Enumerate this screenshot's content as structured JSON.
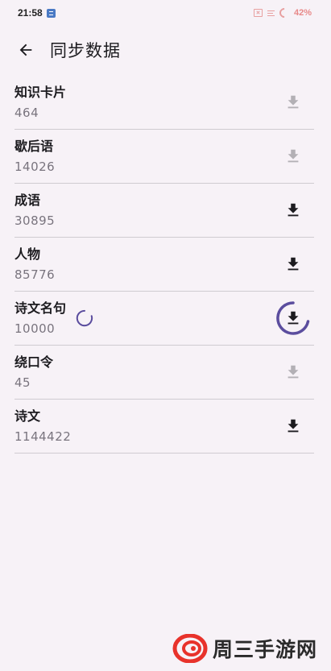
{
  "status_bar": {
    "time": "21:58",
    "battery": "42%"
  },
  "header": {
    "title": "同步数据"
  },
  "items": [
    {
      "name": "知识卡片",
      "count": "464",
      "state": "downloaded"
    },
    {
      "name": "歇后语",
      "count": "14026",
      "state": "downloaded"
    },
    {
      "name": "成语",
      "count": "30895",
      "state": "available"
    },
    {
      "name": "人物",
      "count": "85776",
      "state": "available"
    },
    {
      "name": "诗文名句",
      "count": "10000",
      "state": "downloading"
    },
    {
      "name": "绕口令",
      "count": "45",
      "state": "downloaded"
    },
    {
      "name": "诗文",
      "count": "1144422",
      "state": "available"
    }
  ],
  "watermark": {
    "text": "周三手游网"
  },
  "colors": {
    "background": "#f7f2f7",
    "accent": "#5b4d9e",
    "icon_active": "#1c1b1f",
    "icon_disabled": "#b3b0b5",
    "divider": "#cfcbd1",
    "watermark_logo": "#e8322b"
  }
}
